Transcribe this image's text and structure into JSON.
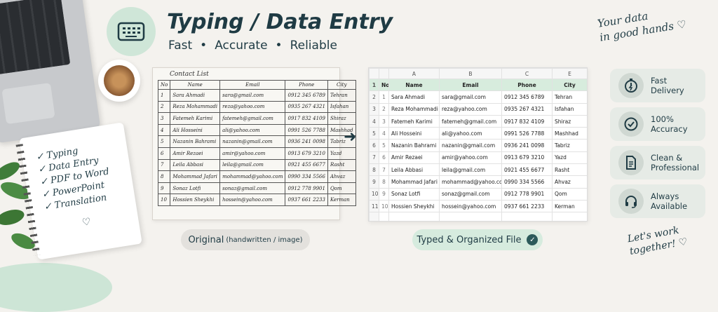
{
  "header": {
    "title": "Typing / Data Entry",
    "subtitle_items": [
      "Fast",
      "Accurate",
      "Reliable"
    ],
    "icon": "keyboard-icon"
  },
  "notebook": {
    "items": [
      "Typing",
      "Data Entry",
      "PDF to Word",
      "PowerPoint",
      "Translation"
    ]
  },
  "original_sheet": {
    "caption": "Contact List",
    "columns": [
      "No",
      "Name",
      "Email",
      "Phone",
      "City"
    ],
    "rows": [
      [
        "1",
        "Sara Ahmadi",
        "sara@gmail.com",
        "0912 345 6789",
        "Tehran"
      ],
      [
        "2",
        "Reza Mohammadi",
        "reza@yahoo.com",
        "0935 267 4321",
        "Isfahan"
      ],
      [
        "3",
        "Fatemeh Karimi",
        "fatemeh@gmail.com",
        "0917 832 4109",
        "Shiraz"
      ],
      [
        "4",
        "Ali Hosseini",
        "ali@yahoo.com",
        "0991 526 7788",
        "Mashhad"
      ],
      [
        "5",
        "Nazanin Bahrami",
        "nazanin@gmail.com",
        "0936 241 0098",
        "Tabriz"
      ],
      [
        "6",
        "Amir Rezaei",
        "amir@yahoo.com",
        "0913 679 3210",
        "Yazd"
      ],
      [
        "7",
        "Leila Abbasi",
        "leila@gmail.com",
        "0921 455 6677",
        "Rasht"
      ],
      [
        "8",
        "Mohammad Jafari",
        "mohammad@yahoo.com",
        "0990 334 5566",
        "Ahvaz"
      ],
      [
        "9",
        "Sonaz Lotfi",
        "sonaz@gmail.com",
        "0912 778 9901",
        "Qom"
      ],
      [
        "10",
        "Hossien Sheykhi",
        "hossein@yahoo.com",
        "0937 661 2233",
        "Kerman"
      ]
    ]
  },
  "typed_sheet": {
    "col_letters": [
      "",
      "A",
      "B",
      "C",
      "E"
    ],
    "columns": [
      "No",
      "Name",
      "Email",
      "Phone",
      "City"
    ],
    "rows": [
      [
        "1",
        "Sara Ahmadi",
        "sara@gmail.com",
        "0912 345 6789",
        "Tehran"
      ],
      [
        "2",
        "Reza Mohammadi",
        "reza@yahoo.com",
        "0935 267 4321",
        "Isfahan"
      ],
      [
        "3",
        "Fatemeh Karimi",
        "fatemeh@gmail.com",
        "0917 832 4109",
        "Shiraz"
      ],
      [
        "4",
        "Ali Hosseini",
        "ali@yahoo.com",
        "0991 526 7788",
        "Mashhad"
      ],
      [
        "5",
        "Nazanin Bahrami",
        "nazanin@gmail.com",
        "0936 241 0098",
        "Tabriz"
      ],
      [
        "6",
        "Amir Rezaei",
        "amir@yahoo.com",
        "0913 679 3210",
        "Yazd"
      ],
      [
        "7",
        "Leila Abbasi",
        "leila@gmail.com",
        "0921 455 6677",
        "Rasht"
      ],
      [
        "8",
        "Mohammad Jafari",
        "mohammad@yahoo.com",
        "0990 334 5566",
        "Ahvaz"
      ],
      [
        "9",
        "Sonaz Lotfi",
        "sonaz@gmail.com",
        "0912 778 9901",
        "Qom"
      ],
      [
        "10",
        "Hossien Sheykhi",
        "hossein@yahoo.com",
        "0937 661 2233",
        "Kerman"
      ]
    ],
    "row_numbers": [
      "1",
      "2",
      "3",
      "4",
      "5",
      "6",
      "7",
      "8",
      "9",
      "10",
      "11"
    ]
  },
  "labels": {
    "original": "Original",
    "original_note": "(handwritten / image)",
    "typed": "Typed & Organized File"
  },
  "right": {
    "tagline_top": [
      "Your data",
      "in good hands ♡"
    ],
    "features": [
      {
        "icon": "stopwatch-icon",
        "lines": [
          "Fast",
          "Delivery"
        ]
      },
      {
        "icon": "check-circle-icon",
        "lines": [
          "100%",
          "Accuracy"
        ]
      },
      {
        "icon": "document-icon",
        "lines": [
          "Clean &",
          "Professional"
        ]
      },
      {
        "icon": "headset-icon",
        "lines": [
          "Always",
          "Available"
        ]
      }
    ],
    "tagline_bottom": [
      "Let's work",
      "together! ♡"
    ]
  },
  "colors": {
    "primary": "#1f3b44",
    "mint": "#cfe6d8",
    "header_green": "#d7ecdd",
    "background": "#f4f2ee"
  }
}
